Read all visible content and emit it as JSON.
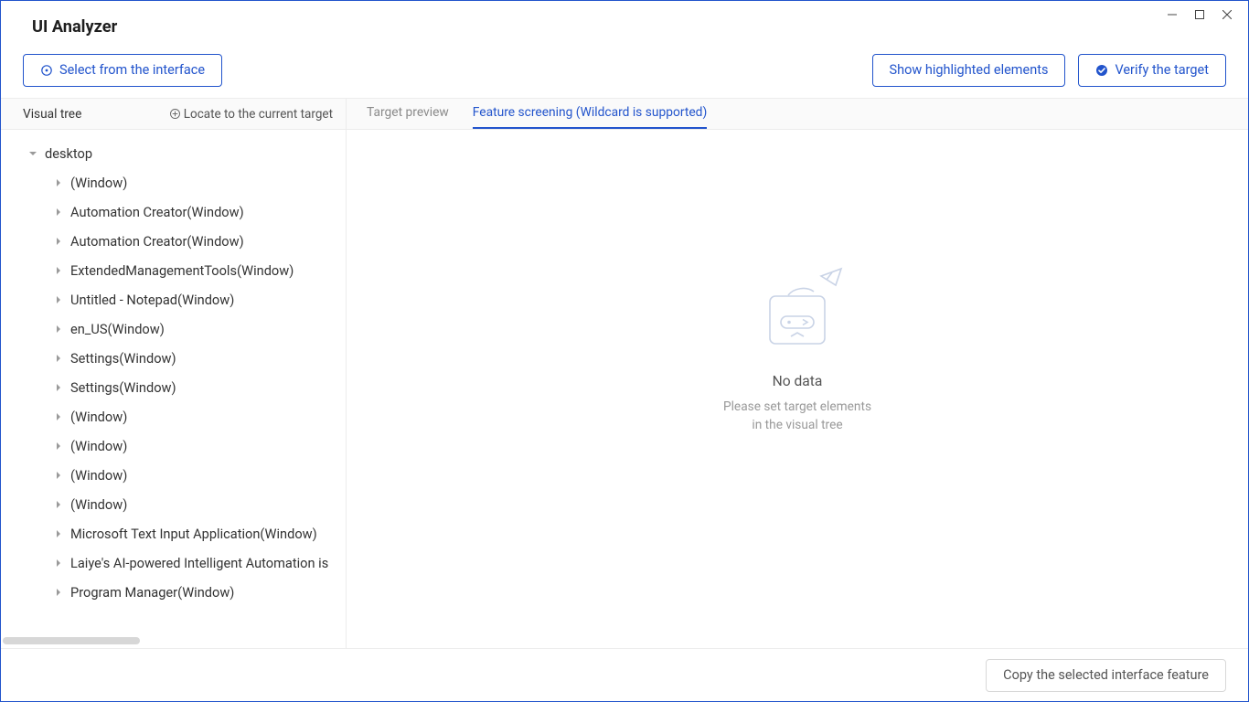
{
  "app_title": "UI Analyzer",
  "toolbar": {
    "select_label": "Select from the interface",
    "show_highlighted_label": "Show highlighted elements",
    "verify_label": "Verify the target"
  },
  "left": {
    "header_title": "Visual tree",
    "locate_label": "Locate to the current target"
  },
  "tree": {
    "root_label": "desktop",
    "children": [
      "(Window)",
      "Automation Creator(Window)",
      "Automation Creator(Window)",
      "ExtendedManagementTools(Window)",
      "Untitled - Notepad(Window)",
      "en_US(Window)",
      "Settings(Window)",
      "Settings(Window)",
      "(Window)",
      "(Window)",
      "(Window)",
      "(Window)",
      "Microsoft Text Input Application(Window)",
      "Laiye's AI-powered Intelligent Automation is",
      "Program Manager(Window)"
    ]
  },
  "tabs": {
    "preview_label": "Target preview",
    "feature_label": "Feature screening (Wildcard is supported)"
  },
  "empty": {
    "title": "No data",
    "line1": "Please set target elements",
    "line2": "in the visual tree"
  },
  "footer": {
    "copy_label": "Copy the selected interface feature"
  }
}
